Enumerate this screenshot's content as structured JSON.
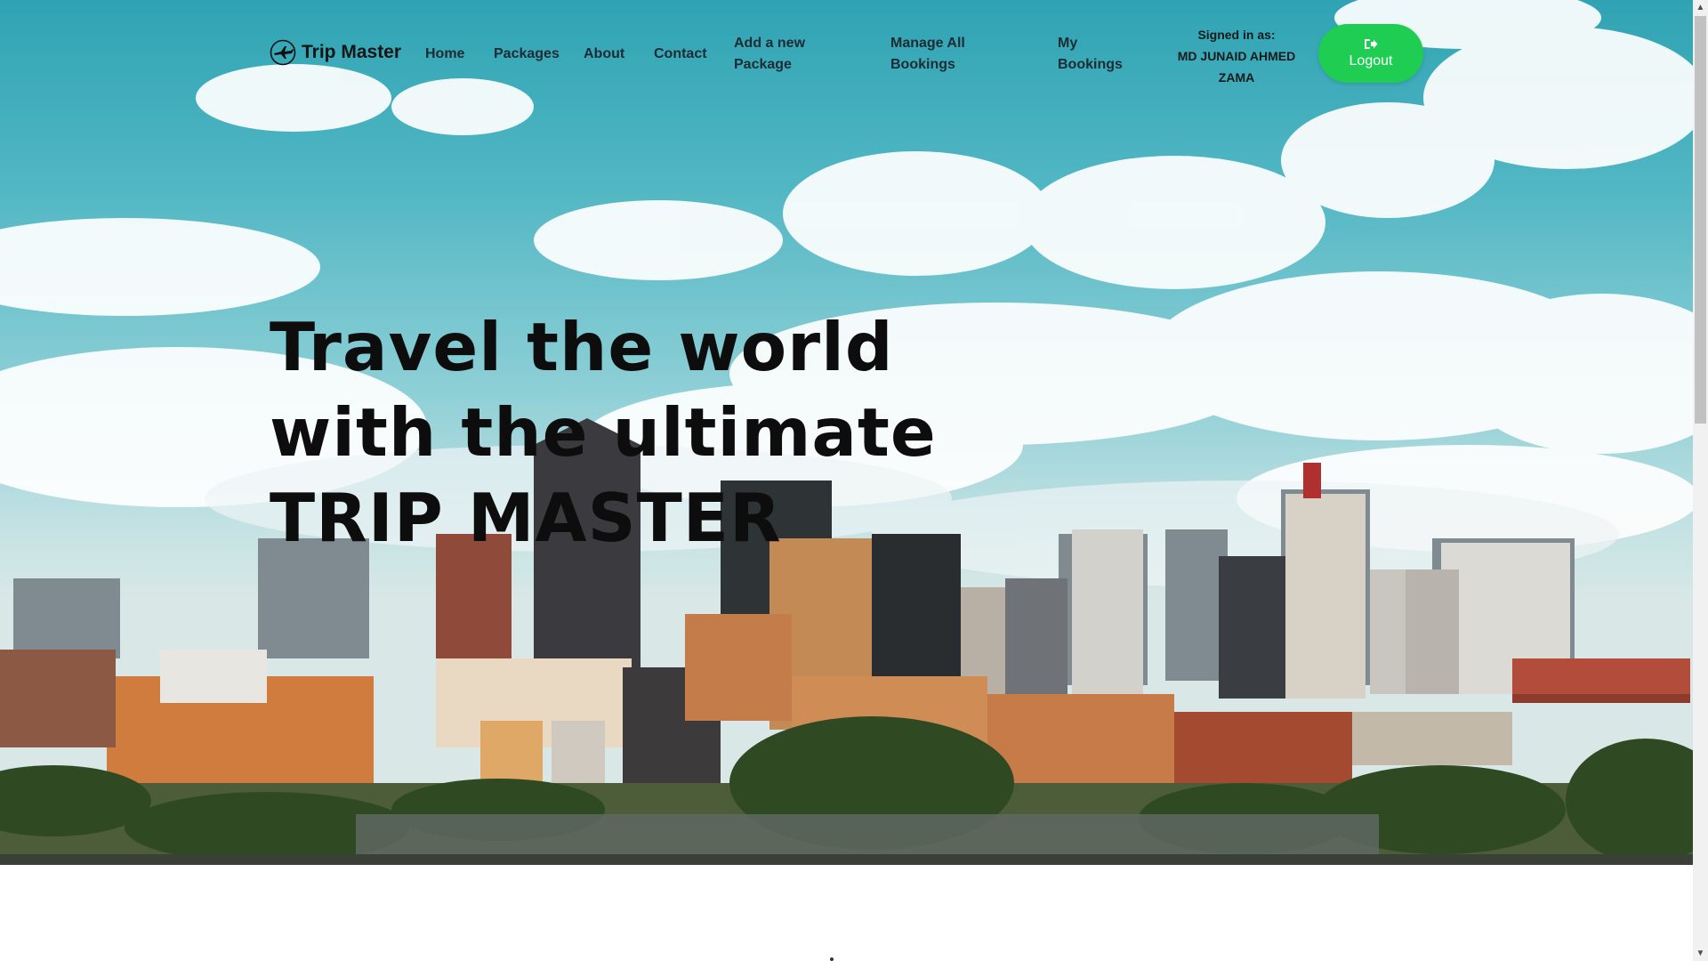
{
  "brand": {
    "name": "Trip Master",
    "icon": "airplane-icon"
  },
  "nav": {
    "home": "Home",
    "packages": "Packages",
    "about": "About",
    "contact": "Contact",
    "add_package": "Add a new Package",
    "manage_bookings": "Manage All Bookings",
    "my_bookings": "My Bookings"
  },
  "user": {
    "signed_in_label": "Signed in as:",
    "name": "MD JUNAID AHMED ZAMA"
  },
  "logout": {
    "label": "Logout",
    "icon": "sign-out-icon",
    "color": "#1fcd52"
  },
  "hero": {
    "line1": "Travel the world",
    "line2": "with the ultimate",
    "line3": "TRIP MASTER",
    "background": "city-skyline-photo"
  }
}
